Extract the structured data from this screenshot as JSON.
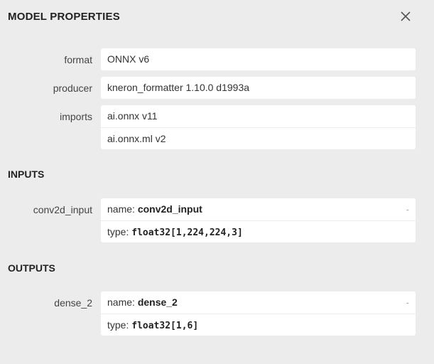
{
  "dialog": {
    "title": "MODEL PROPERTIES",
    "close_icon": "close-icon"
  },
  "properties": {
    "format": {
      "label": "format",
      "value": "ONNX v6"
    },
    "producer": {
      "label": "producer",
      "value": "kneron_formatter 1.10.0 d1993a"
    },
    "imports": {
      "label": "imports",
      "values": [
        "ai.onnx v11",
        "ai.onnx.ml v2"
      ]
    }
  },
  "inputs": {
    "title": "INPUTS",
    "items": [
      {
        "label": "conv2d_input",
        "name_prefix": "name: ",
        "name": "conv2d_input",
        "type_prefix": "type: ",
        "type": "float32[1,224,224,3]",
        "expander": "-"
      }
    ]
  },
  "outputs": {
    "title": "OUTPUTS",
    "items": [
      {
        "label": "dense_2",
        "name_prefix": "name: ",
        "name": "dense_2",
        "type_prefix": "type: ",
        "type": "float32[1,6]",
        "expander": "-"
      }
    ]
  }
}
